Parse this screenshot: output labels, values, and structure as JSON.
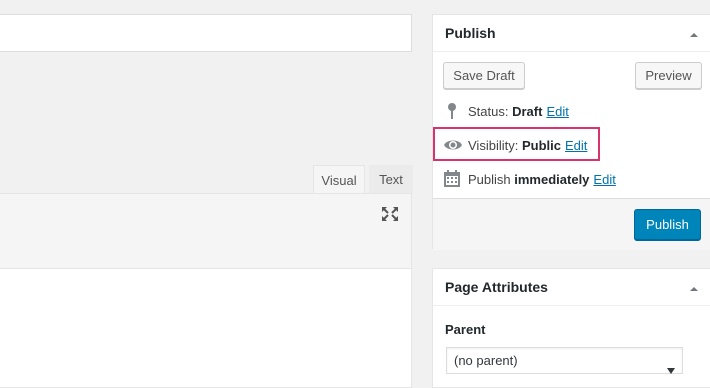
{
  "editor": {
    "tabs": [
      {
        "label": "Visual"
      },
      {
        "label": "Text"
      }
    ],
    "fullscreen_icon": "fullscreen-icon"
  },
  "publish": {
    "title": "Publish",
    "save_draft": "Save Draft",
    "preview": "Preview",
    "status_label": "Status:",
    "status_value": "Draft",
    "visibility_label": "Visibility:",
    "visibility_value": "Public",
    "publish_label": "Publish",
    "publish_value": "immediately",
    "edit": "Edit",
    "publish_button": "Publish"
  },
  "page_attributes": {
    "title": "Page Attributes",
    "parent_label": "Parent",
    "parent_value": "(no parent)"
  },
  "colors": {
    "accent": "#0085ba",
    "link": "#0073aa",
    "highlight": "#d9336d"
  }
}
